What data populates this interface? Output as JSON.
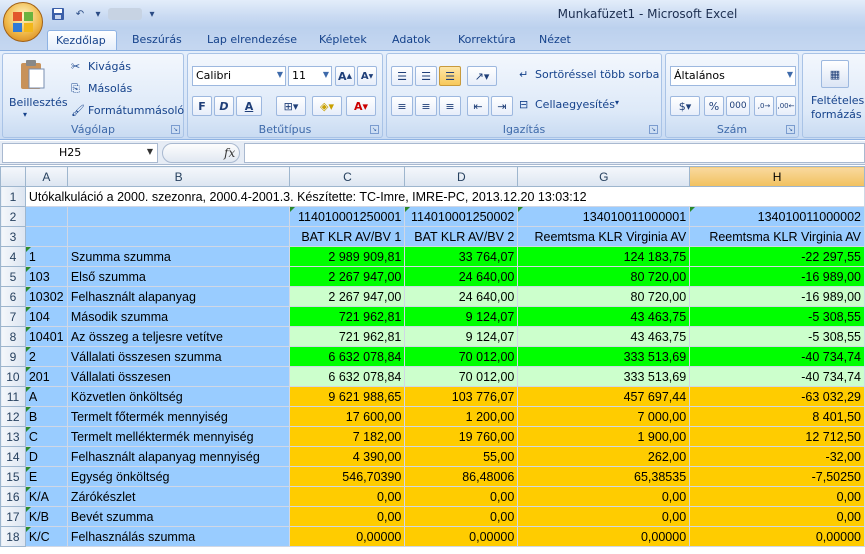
{
  "window": {
    "title": "Munkafüzet1 - Microsoft Excel"
  },
  "tabs": [
    "Kezdőlap",
    "Beszúrás",
    "Lap elrendezése",
    "Képletek",
    "Adatok",
    "Korrektúra",
    "Nézet"
  ],
  "ribbon": {
    "clipboard": {
      "label": "Vágólap",
      "paste": "Beillesztés",
      "cut": "Kivágás",
      "copy": "Másolás",
      "format_painter": "Formátummásoló"
    },
    "font": {
      "label": "Betűtípus",
      "font_name": "Calibri",
      "font_size": "11",
      "bold": "F",
      "italic": "D",
      "underline": "A"
    },
    "alignment": {
      "label": "Igazítás",
      "wrap_text": "Sortöréssel több sorba",
      "merge": "Cellaegyesítés"
    },
    "number": {
      "label": "Szám",
      "format": "Általános",
      "percent": "%",
      "thousands": "000"
    },
    "styles": {
      "conditional_line1": "Feltételes",
      "conditional_line2": "formázás"
    }
  },
  "formula_bar": {
    "name_box": "H25",
    "fx": "fx",
    "content": ""
  },
  "sheet": {
    "columns": [
      "A",
      "B",
      "C",
      "D",
      "G",
      "H"
    ],
    "selected_column": "H",
    "title_row": "Utókalkuláció a 2000. szezonra, 2000.4-2001.3. Készítette: TC-Imre, IMRE-PC, 2013.12.20 13:03:12",
    "codes": [
      "114010001250001",
      "114010001250002",
      "134010011000001",
      "134010011000002"
    ],
    "products": [
      "BAT KLR AV/BV 1",
      "BAT KLR AV/BV 2",
      "Reemtsma KLR Virginia AV",
      "Reemtsma KLR Virginia AV"
    ],
    "rows": [
      {
        "n": "4",
        "a": "1",
        "b": "Szumma szumma",
        "c": "2 989 909,81",
        "d": "33 764,07",
        "g": "124 183,75",
        "h": "-22 297,55",
        "color": "green"
      },
      {
        "n": "5",
        "a": "103",
        "b": "Első szumma",
        "c": "2 267 947,00",
        "d": "24 640,00",
        "g": "80 720,00",
        "h": "-16 989,00",
        "color": "green"
      },
      {
        "n": "6",
        "a": "10302",
        "b": "Felhasznált alapanyag",
        "c": "2 267 947,00",
        "d": "24 640,00",
        "g": "80 720,00",
        "h": "-16 989,00",
        "color": "lgreen"
      },
      {
        "n": "7",
        "a": "104",
        "b": "Második szumma",
        "c": "721 962,81",
        "d": "9 124,07",
        "g": "43 463,75",
        "h": "-5 308,55",
        "color": "green"
      },
      {
        "n": "8",
        "a": "10401",
        "b": "Az összeg a teljesre vetítve",
        "c": "721 962,81",
        "d": "9 124,07",
        "g": "43 463,75",
        "h": "-5 308,55",
        "color": "lgreen"
      },
      {
        "n": "9",
        "a": "2",
        "b": "Vállalati összesen szumma",
        "c": "6 632 078,84",
        "d": "70 012,00",
        "g": "333 513,69",
        "h": "-40 734,74",
        "color": "green"
      },
      {
        "n": "10",
        "a": "201",
        "b": "Vállalati összesen",
        "c": "6 632 078,84",
        "d": "70 012,00",
        "g": "333 513,69",
        "h": "-40 734,74",
        "color": "lgreen"
      },
      {
        "n": "11",
        "a": "A",
        "b": "Közvetlen önköltség",
        "c": "9 621 988,65",
        "d": "103 776,07",
        "g": "457 697,44",
        "h": "-63 032,29",
        "color": "orange"
      },
      {
        "n": "12",
        "a": "B",
        "b": "Termelt főtermék mennyiség",
        "c": "17 600,00",
        "d": "1 200,00",
        "g": "7 000,00",
        "h": "8 401,50",
        "color": "orange"
      },
      {
        "n": "13",
        "a": "C",
        "b": "Termelt melléktermék mennyiség",
        "c": "7 182,00",
        "d": "19 760,00",
        "g": "1 900,00",
        "h": "12 712,50",
        "color": "orange"
      },
      {
        "n": "14",
        "a": "D",
        "b": "Felhasznált alapanyag mennyiség",
        "c": "4 390,00",
        "d": "55,00",
        "g": "262,00",
        "h": "-32,00",
        "color": "orange"
      },
      {
        "n": "15",
        "a": "E",
        "b": "Egység önköltség",
        "c": "546,70390",
        "d": "86,48006",
        "g": "65,38535",
        "h": "-7,50250",
        "color": "orange"
      },
      {
        "n": "16",
        "a": "K/A",
        "b": "Zárókészlet",
        "c": "0,00",
        "d": "0,00",
        "g": "0,00",
        "h": "0,00",
        "color": "orange"
      },
      {
        "n": "17",
        "a": "K/B",
        "b": "Bevét szumma",
        "c": "0,00",
        "d": "0,00",
        "g": "0,00",
        "h": "0,00",
        "color": "orange"
      },
      {
        "n": "18",
        "a": "K/C",
        "b": "Felhasználás szumma",
        "c": "0,00000",
        "d": "0,00000",
        "g": "0,00000",
        "h": "0,00000",
        "color": "orange"
      }
    ]
  },
  "colors": {
    "header_blue": "#99ccff",
    "green": "#00ff00",
    "light_green": "#ccffcc",
    "orange": "#ffcc00",
    "selected_header": "#f6c96a"
  }
}
